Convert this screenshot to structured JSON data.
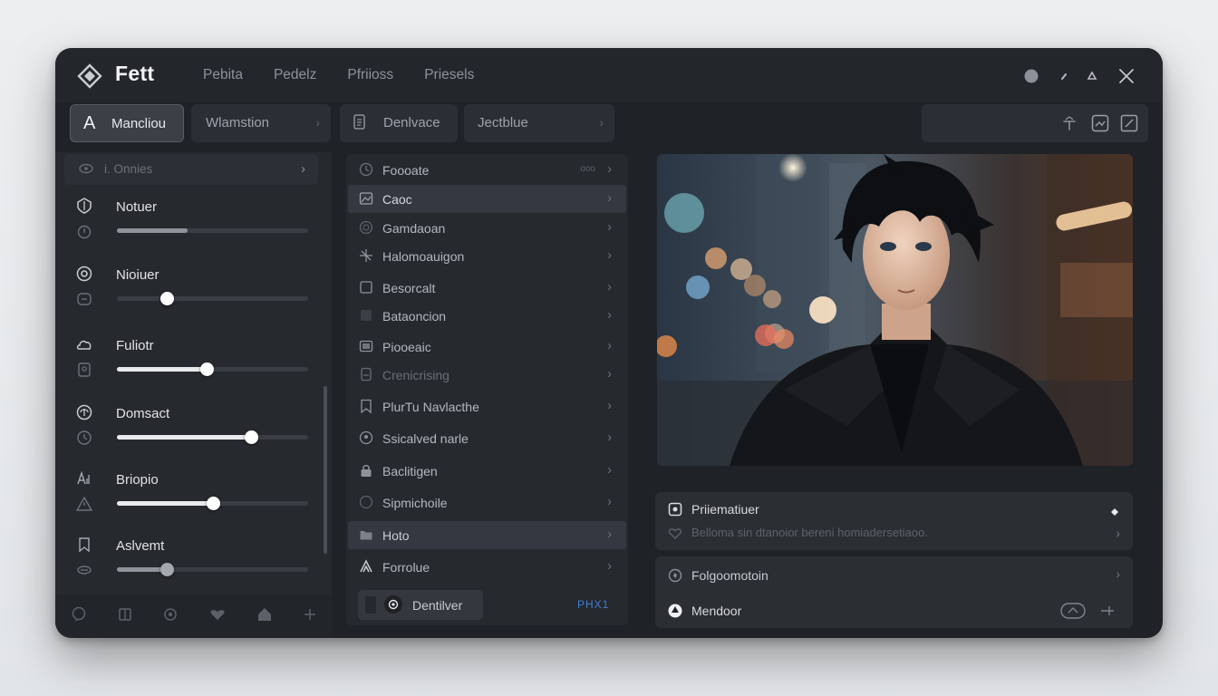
{
  "app": {
    "title": "Fett"
  },
  "menu": [
    {
      "label": "Pebita"
    },
    {
      "label": "Pedelz"
    },
    {
      "label": "Pfriioss"
    },
    {
      "label": "Priesels"
    }
  ],
  "toolbar": {
    "buttons": [
      {
        "glyph": "A",
        "label": "Mancliou"
      },
      {
        "label": "Wlamstion"
      },
      {
        "label": "Denlvace"
      },
      {
        "label": "Jectblue"
      }
    ]
  },
  "left_panel": {
    "header": "i. Onnies",
    "sliders": [
      {
        "label": "Notuer",
        "value": 0.37
      },
      {
        "label": "Nioiuer",
        "value": 0.26
      },
      {
        "label": "Fuliotr",
        "value": 0.47
      },
      {
        "label": "Domsact",
        "value": 0.7
      },
      {
        "label": "Briopio",
        "value": 0.5
      },
      {
        "label": "Aslvemt",
        "value": 0.26
      }
    ]
  },
  "list": {
    "items": [
      {
        "label": "Foooate",
        "badge": "ooo"
      },
      {
        "label": "Caoc",
        "selected": true
      },
      {
        "label": "Gamdaoan"
      },
      {
        "label": "Halomoauigon"
      },
      {
        "label": "Besorcalt"
      },
      {
        "label": "Bataoncion"
      },
      {
        "label": "Piooeaic"
      },
      {
        "label": "Crenicrising"
      },
      {
        "label": "PlurTu Navlacthe"
      },
      {
        "label": "Ssicalved narle"
      },
      {
        "label": "Baclitigen"
      },
      {
        "label": "Sipmichoile"
      },
      {
        "label": "Hoto",
        "selected": true
      },
      {
        "label": "Forrolue"
      }
    ],
    "bottom_button": "Dentilver",
    "shortcut": "PHX1"
  },
  "details": {
    "card1": {
      "title": "Priiematiuer",
      "subtitle": "Belloma sin dtanoior bereni homiadersetiaoo."
    },
    "card2": {
      "row1": "Folgoomotoin",
      "row2": "Mendoor"
    }
  },
  "colors": {
    "accent": "#3e7fd3",
    "window": "#1f2226",
    "panel": "#26292e"
  }
}
